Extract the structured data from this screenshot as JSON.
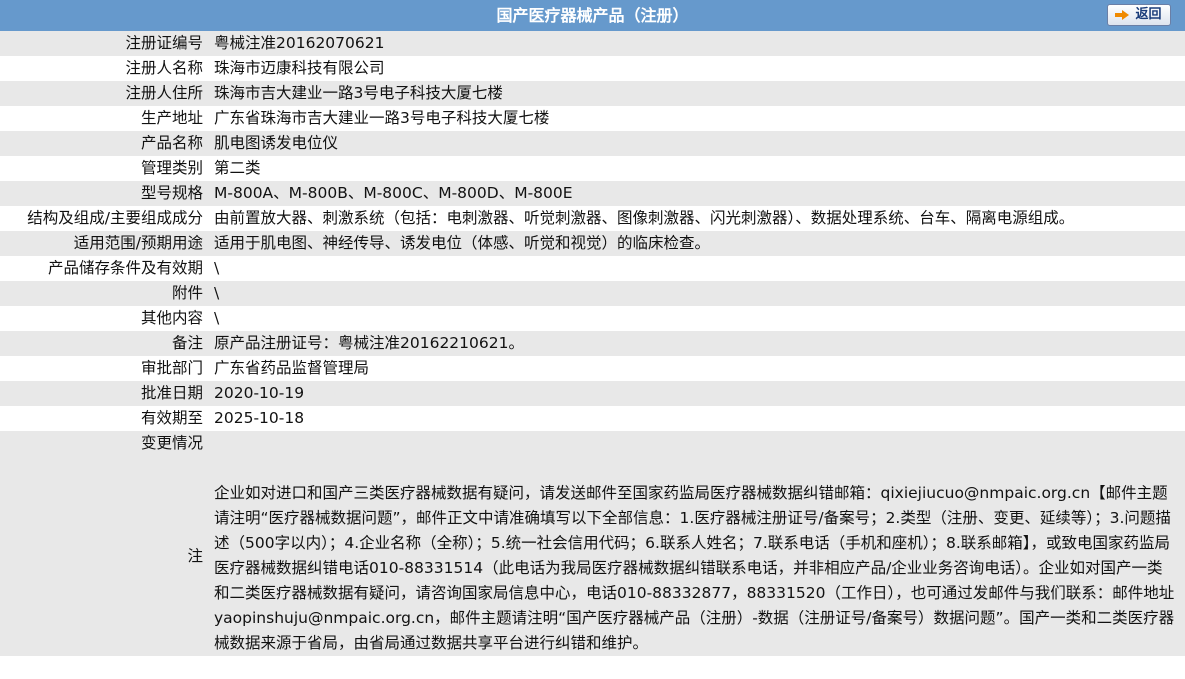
{
  "header": {
    "title": "国产医疗器械产品（注册）",
    "back_label": "返回"
  },
  "rows": [
    {
      "label": "注册证编号",
      "value": "粤械注准20162070621"
    },
    {
      "label": "注册人名称",
      "value": "珠海市迈康科技有限公司"
    },
    {
      "label": "注册人住所",
      "value": "珠海市吉大建业一路3号电子科技大厦七楼"
    },
    {
      "label": "生产地址",
      "value": "广东省珠海市吉大建业一路3号电子科技大厦七楼"
    },
    {
      "label": "产品名称",
      "value": "肌电图诱发电位仪"
    },
    {
      "label": "管理类别",
      "value": "第二类"
    },
    {
      "label": "型号规格",
      "value": "M-800A、M-800B、M-800C、M-800D、M-800E"
    },
    {
      "label": "结构及组成/主要组成成分",
      "value": "由前置放大器、刺激系统（包括：电刺激器、听觉刺激器、图像刺激器、闪光刺激器）、数据处理系统、台车、隔离电源组成。"
    },
    {
      "label": "适用范围/预期用途",
      "value": "适用于肌电图、神经传导、诱发电位（体感、听觉和视觉）的临床检查。"
    },
    {
      "label": "产品储存条件及有效期",
      "value": "\\"
    },
    {
      "label": "附件",
      "value": "\\"
    },
    {
      "label": "其他内容",
      "value": "\\"
    },
    {
      "label": "备注",
      "value": "原产品注册证号：粤械注准20162210621。"
    },
    {
      "label": "审批部门",
      "value": "广东省药品监督管理局"
    },
    {
      "label": "批准日期",
      "value": "2020-10-19"
    },
    {
      "label": "有效期至",
      "value": "2025-10-18"
    },
    {
      "label": "变更情况",
      "value": ""
    }
  ],
  "note": {
    "label": "注",
    "text": "企业如对进口和国产三类医疗器械数据有疑问，请发送邮件至国家药监局医疗器械数据纠错邮箱：qixiejiucuo@nmpaic.org.cn【邮件主题请注明“医疗器械数据问题”，邮件正文中请准确填写以下全部信息：1.医疗器械注册证号/备案号；2.类型（注册、变更、延续等）；3.问题描述（500字以内）；4.企业名称（全称）；5.统一社会信用代码；6.联系人姓名；7.联系电话（手机和座机）；8.联系邮箱】，或致电国家药监局医疗器械数据纠错电话010-88331514（此电话为我局医疗器械数据纠错联系电话，并非相应产品/企业业务咨询电话）。企业如对国产一类和二类医疗器械数据有疑问，请咨询国家局信息中心，电话010-88332877，88331520（工作日），也可通过发邮件与我们联系：邮件地址yaopinshuju@nmpaic.org.cn，邮件主题请注明“国产医疗器械产品（注册）-数据（注册证号/备案号）数据问题”。国产一类和二类医疗器械数据来源于省局，由省局通过数据共享平台进行纠错和维护。"
  }
}
